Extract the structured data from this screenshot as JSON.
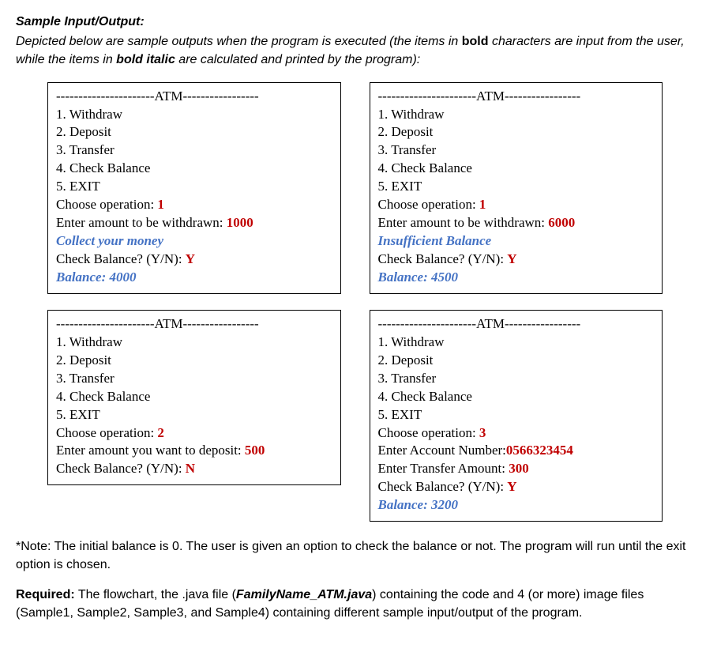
{
  "heading": "Sample Input/Output:",
  "intro": {
    "pre": "Depicted below are sample outputs when the program is executed (the items in ",
    "bold": "bold",
    "mid": " characters are input from the user, while the items in ",
    "bolditalic": "bold italic",
    "post": " are calculated and printed by the program):"
  },
  "atm_header": "----------------------ATM-----------------",
  "menu": [
    "1. Withdraw",
    "2. Deposit",
    "3. Transfer",
    "4. Check Balance",
    "5. EXIT"
  ],
  "boxes": {
    "b1": {
      "p1": {
        "label": "Choose operation: ",
        "input": "1"
      },
      "p2": {
        "label": "Enter amount to be withdrawn: ",
        "input": "1000"
      },
      "out1": "Collect your money",
      "p3": {
        "label": "Check Balance? (Y/N): ",
        "input": "Y"
      },
      "out2": "Balance: 4000"
    },
    "b2": {
      "p1": {
        "label": "Choose operation: ",
        "input": "1"
      },
      "p2": {
        "label": "Enter amount to be withdrawn: ",
        "input": "6000"
      },
      "out1": "Insufficient Balance",
      "p3": {
        "label": "Check Balance? (Y/N): ",
        "input": "Y"
      },
      "out2": "Balance: 4500"
    },
    "b3": {
      "p1": {
        "label": "Choose operation: ",
        "input": "2"
      },
      "p2": {
        "label": "Enter amount you want to deposit: ",
        "input": "500"
      },
      "p3": {
        "label": "Check Balance? (Y/N): ",
        "input": "N"
      }
    },
    "b4": {
      "p1": {
        "label": "Choose operation: ",
        "input": "3"
      },
      "p2": {
        "label": "Enter Account Number:",
        "input": "0566323454"
      },
      "p3": {
        "label": "Enter Transfer Amount: ",
        "input": "300"
      },
      "p4": {
        "label": "Check Balance? (Y/N): ",
        "input": "Y"
      },
      "out1": "Balance: 3200"
    }
  },
  "note": "*Note: The initial balance is 0. The user is given an option to check the balance or not. The program will run until the exit option is chosen.",
  "required": {
    "label": "Required:",
    "pre": " The flowchart, the .java file (",
    "filename": "FamilyName_ATM.java",
    "post": ") containing the code and 4 (or more) image files (Sample1, Sample2, Sample3, and Sample4) containing different sample input/output of the program."
  }
}
